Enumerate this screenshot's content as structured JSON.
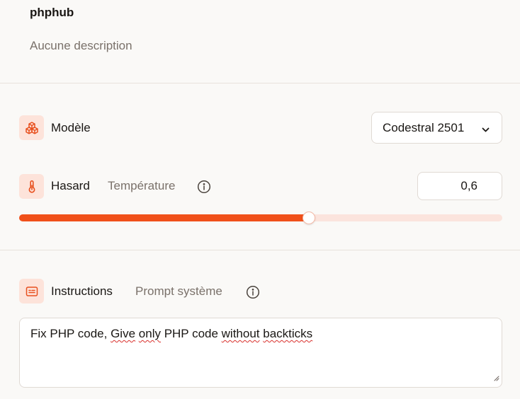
{
  "agent": {
    "name": "phphub",
    "description": "Aucune description"
  },
  "model": {
    "label": "Modèle",
    "icon": "cubes-icon",
    "selected": "Codestral 2501"
  },
  "temperature": {
    "label": "Hasard",
    "sublabel": "Température",
    "icon": "thermometer-icon",
    "value": "0,6",
    "slider_fraction": 0.6
  },
  "instructions": {
    "label": "Instructions",
    "sublabel": "Prompt système",
    "icon": "text-card-icon",
    "text_parts": [
      "Fix PHP code, ",
      "Give",
      " ",
      "only",
      " PHP code ",
      "without",
      " ",
      "backticks"
    ]
  },
  "colors": {
    "accent": "#f0501a",
    "icon_bg": "#fde3da",
    "track": "#fbe4dd"
  }
}
